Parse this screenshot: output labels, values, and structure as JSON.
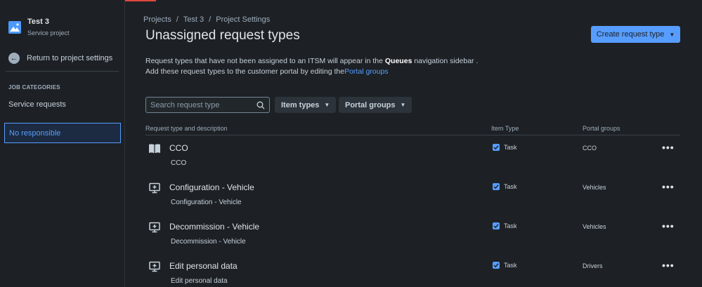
{
  "sidebar": {
    "project_name": "Test 3",
    "project_type": "Service project",
    "return_label": "Return to project settings",
    "section_heading": "JOB CATEGORIES",
    "items": [
      {
        "label": "Service requests"
      },
      {
        "label": "No responsible"
      }
    ]
  },
  "breadcrumb": [
    "Projects",
    "Test 3",
    "Project Settings"
  ],
  "header": {
    "title": "Unassigned request types",
    "create_label": "Create request type"
  },
  "description": {
    "line1_pre": "Request types that have not been assigned to an ITSM will appear in the ",
    "line1_bold": "Queues",
    "line1_post": " navigation sidebar .",
    "line2_pre": "Add these request types to the customer portal by editing the",
    "line2_link": "Portal groups"
  },
  "search": {
    "placeholder": "Search request type",
    "value": ""
  },
  "filters": {
    "item_types": "Item types",
    "portal_groups": "Portal groups"
  },
  "table": {
    "headers": {
      "name": "Request type and description",
      "item_type": "Item Type",
      "portal": "Portal groups"
    },
    "rows": [
      {
        "name": "CCO",
        "description": "CCO",
        "item_type": "Task",
        "portal": "CCO",
        "icon": "book-icon"
      },
      {
        "name": "Configuration - Vehicle",
        "description": "Configuration - Vehicle",
        "item_type": "Task",
        "portal": "Vehicles",
        "icon": "monitor-icon"
      },
      {
        "name": "Decommission - Vehicle",
        "description": "Decommission - Vehicle",
        "item_type": "Task",
        "portal": "Vehicles",
        "icon": "monitor-icon"
      },
      {
        "name": "Edit personal data",
        "description": "Edit personal data",
        "item_type": "Task",
        "portal": "Drivers",
        "icon": "monitor-icon"
      }
    ]
  },
  "colors": {
    "accent": "#579dff",
    "background": "#1d2125"
  }
}
